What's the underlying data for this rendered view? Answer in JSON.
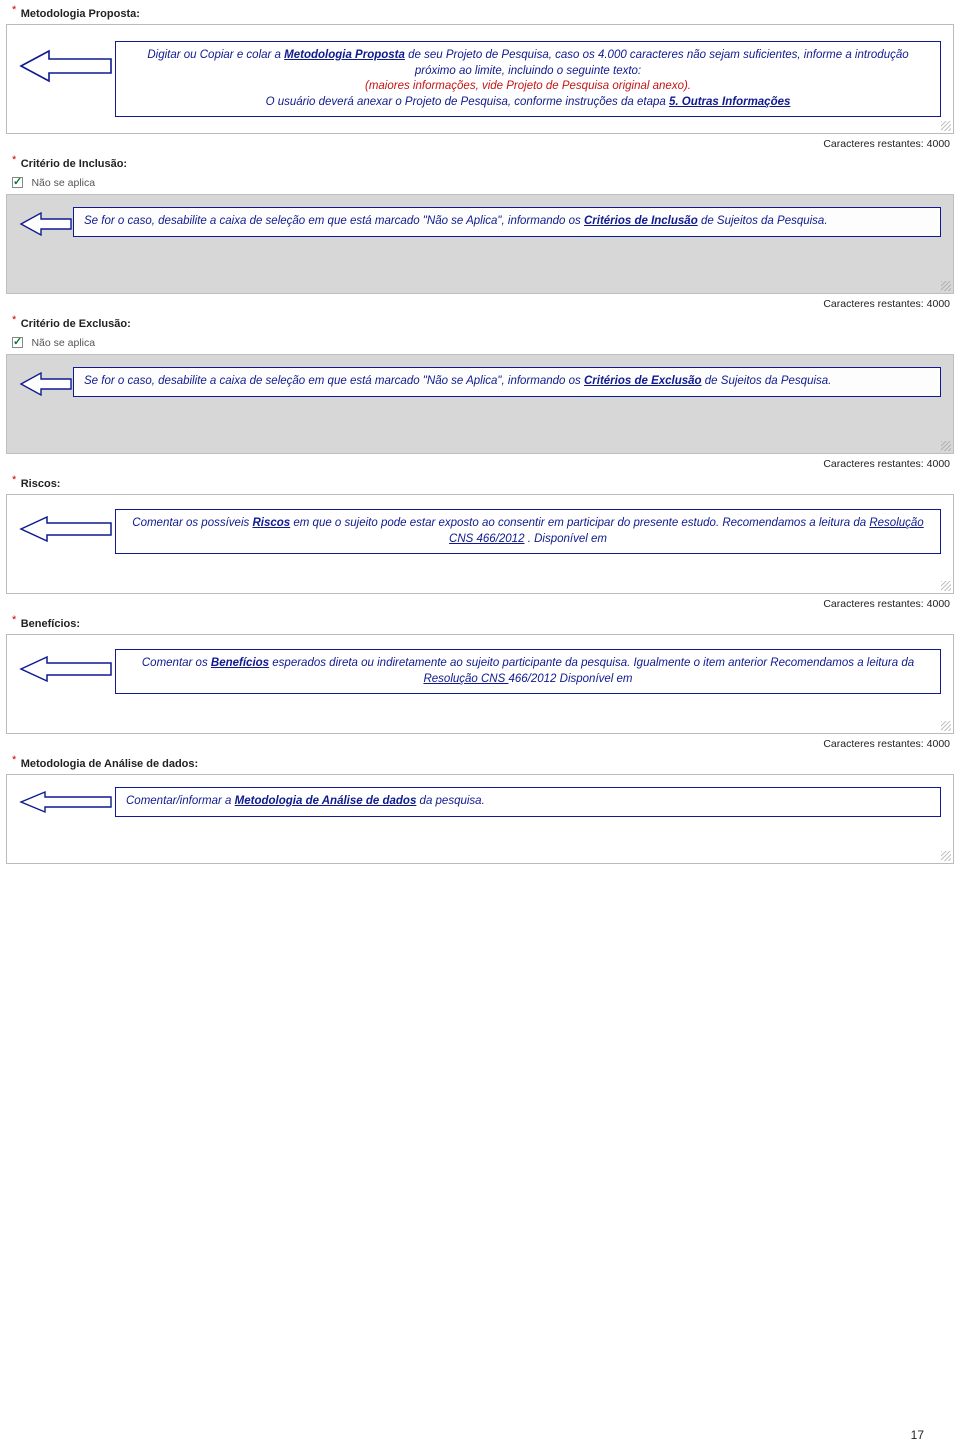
{
  "page_number": "17",
  "counter_label_prefix": "Caracteres restantes: ",
  "sections": {
    "metodologia_proposta": {
      "label": "Metodologia Proposta:",
      "counter": "4000",
      "note_line1_a": "Digitar ou Copiar e colar a ",
      "note_line1_b": "Metodologia Proposta",
      "note_line1_c": " de seu Projeto de Pesquisa, caso os 4.000 caracteres não sejam suficientes, informe a introdução próximo ao limite, incluindo o seguinte texto:",
      "note_red": "(maiores informações, vide Projeto de Pesquisa original anexo).",
      "note_line3_a": "O usuário deverá anexar o Projeto de Pesquisa, conforme instruções da etapa ",
      "note_line3_b": "5. Outras Informações"
    },
    "criterio_inclusao": {
      "label": "Critério de Inclusão:",
      "chk_label": "Não se aplica",
      "counter": "4000",
      "note_a": "Se for o caso, desabilite a caixa de seleção em que está marcado \"Não se Aplica\", informando os ",
      "note_b": "Critérios de Inclusão",
      "note_c": " de Sujeitos da Pesquisa."
    },
    "criterio_exclusao": {
      "label": "Critério de Exclusão:",
      "chk_label": "Não se aplica",
      "counter": "4000",
      "note_a": "Se for o caso, desabilite a caixa de seleção em que está marcado \"Não se Aplica\", informando os ",
      "note_b": "Critérios de Exclusão",
      "note_c": " de Sujeitos da Pesquisa."
    },
    "riscos": {
      "label": "Riscos:",
      "counter": "4000",
      "note_a": "Comentar os possíveis ",
      "note_b": "Riscos",
      "note_c": " em que o sujeito pode estar exposto ao consentir em participar do presente estudo. Recomendamos a leitura da ",
      "note_d": "Resolução CNS 466/2012",
      "note_e": " . Disponível em"
    },
    "beneficios": {
      "label": "Benefícios:",
      "counter": "4000",
      "note_a": "Comentar os ",
      "note_b": "Benefícios",
      "note_c": " esperados direta ou indiretamente ao sujeito participante da pesquisa. Igualmente o item anterior Recomendamos a leitura da ",
      "note_d": "Resolução CNS ",
      "note_e": "466/2012 Disponível em"
    },
    "metodologia_analise": {
      "label": "Metodologia de Análise de dados:",
      "counter": "4000",
      "note_a": "Comentar/informar a  ",
      "note_b": "Metodologia de Análise de dados",
      "note_c": " da pesquisa."
    }
  }
}
